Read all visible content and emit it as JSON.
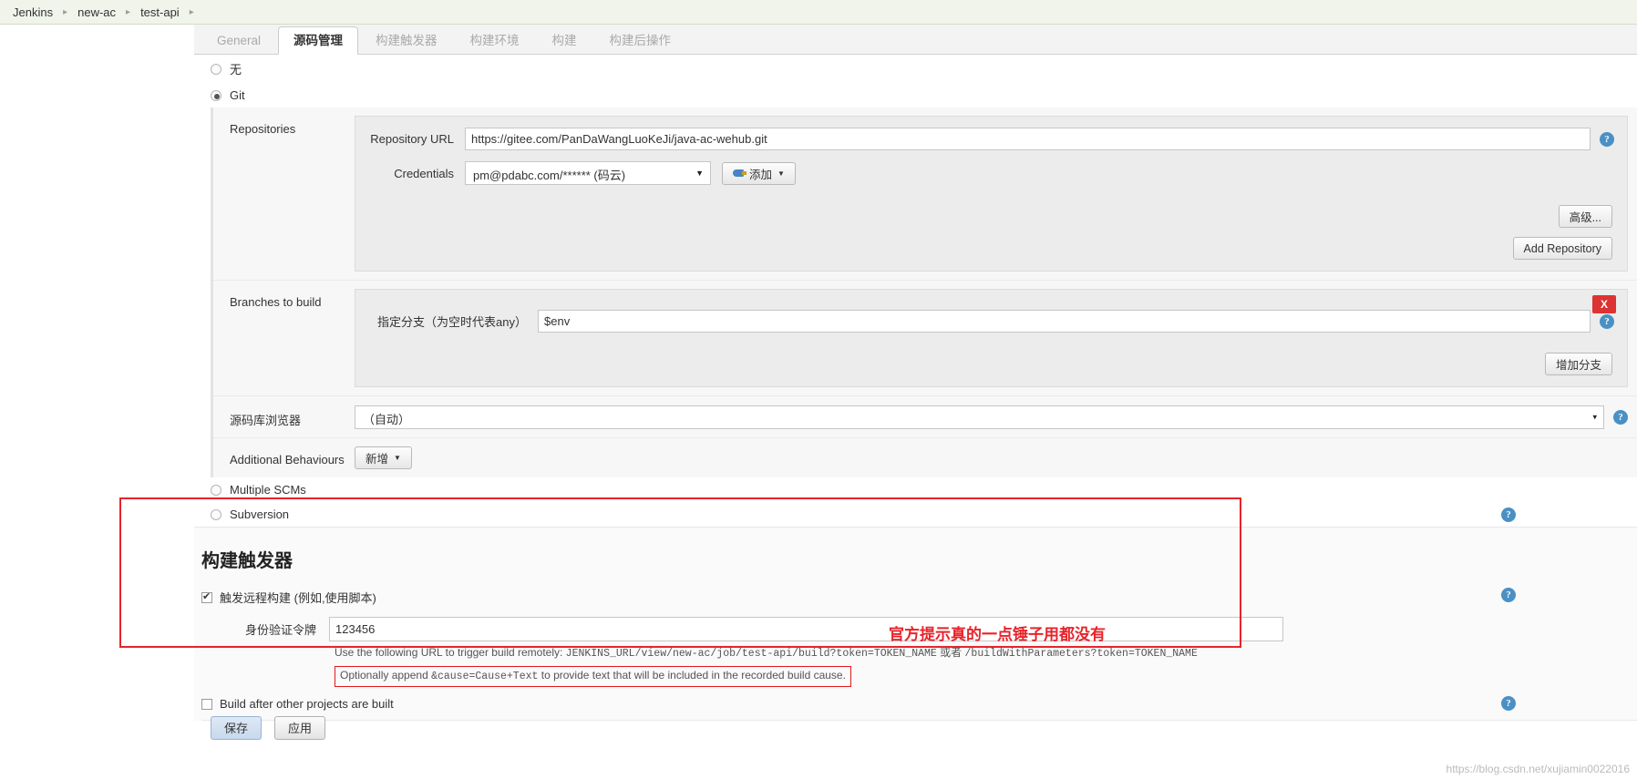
{
  "breadcrumb": {
    "items": [
      "Jenkins",
      "new-ac",
      "test-api"
    ],
    "separator": "▸"
  },
  "tabs": [
    {
      "label": "General",
      "active": false
    },
    {
      "label": "源码管理",
      "active": true
    },
    {
      "label": "构建触发器",
      "active": false
    },
    {
      "label": "构建环境",
      "active": false
    },
    {
      "label": "构建",
      "active": false
    },
    {
      "label": "构建后操作",
      "active": false
    }
  ],
  "scm": {
    "options": [
      {
        "label": "无",
        "checked": false
      },
      {
        "label": "Git",
        "checked": true
      },
      {
        "label": "Multiple SCMs",
        "checked": false
      },
      {
        "label": "Subversion",
        "checked": false
      }
    ],
    "repositories": {
      "section_label": "Repositories",
      "url_label": "Repository URL",
      "url_value": "https://gitee.com/PanDaWangLuoKeJi/java-ac-wehub.git",
      "credentials_label": "Credentials",
      "credentials_value": "pm@pdabc.com/****** (码云)",
      "add_button": "添加",
      "advanced_button": "高级...",
      "add_repository_button": "Add Repository"
    },
    "branches": {
      "section_label": "Branches to build",
      "branch_label": "指定分支（为空时代表any）",
      "branch_value": "$env",
      "delete_label": "X",
      "add_branch_button": "增加分支"
    },
    "browser": {
      "section_label": "源码库浏览器",
      "value": "（自动）"
    },
    "additional": {
      "section_label": "Additional Behaviours",
      "add_button": "新增"
    }
  },
  "triggers": {
    "title": "构建触发器",
    "remote_trigger": {
      "label": "触发远程构建 (例如,使用脚本)",
      "checked": true
    },
    "token": {
      "label": "身份验证令牌",
      "value": "123456"
    },
    "hint_line1_prefix": "Use the following URL to trigger build remotely: ",
    "hint_line1_url": "JENKINS_URL/view/new-ac/job/test-api/build?token=TOKEN_NAME",
    "hint_line1_mid": " 或者 ",
    "hint_line1_url2": "/buildWithParameters?token=TOKEN_NAME",
    "hint_line2_prefix": "Optionally append ",
    "hint_line2_code": "&cause=Cause+Text",
    "hint_line2_suffix": " to provide text that will be included in the recorded build cause.",
    "build_after": {
      "label": "Build after other projects are built",
      "checked": false
    }
  },
  "annotation": {
    "note": "官方提示真的一点锤子用都没有",
    "color": "#e8232a"
  },
  "footer": {
    "save_button": "保存",
    "apply_button": "应用",
    "watermark": "https://blog.csdn.net/xujiamin0022016"
  },
  "icons": {
    "help": "?",
    "caret_down": "▼",
    "caret_small": "▾"
  }
}
